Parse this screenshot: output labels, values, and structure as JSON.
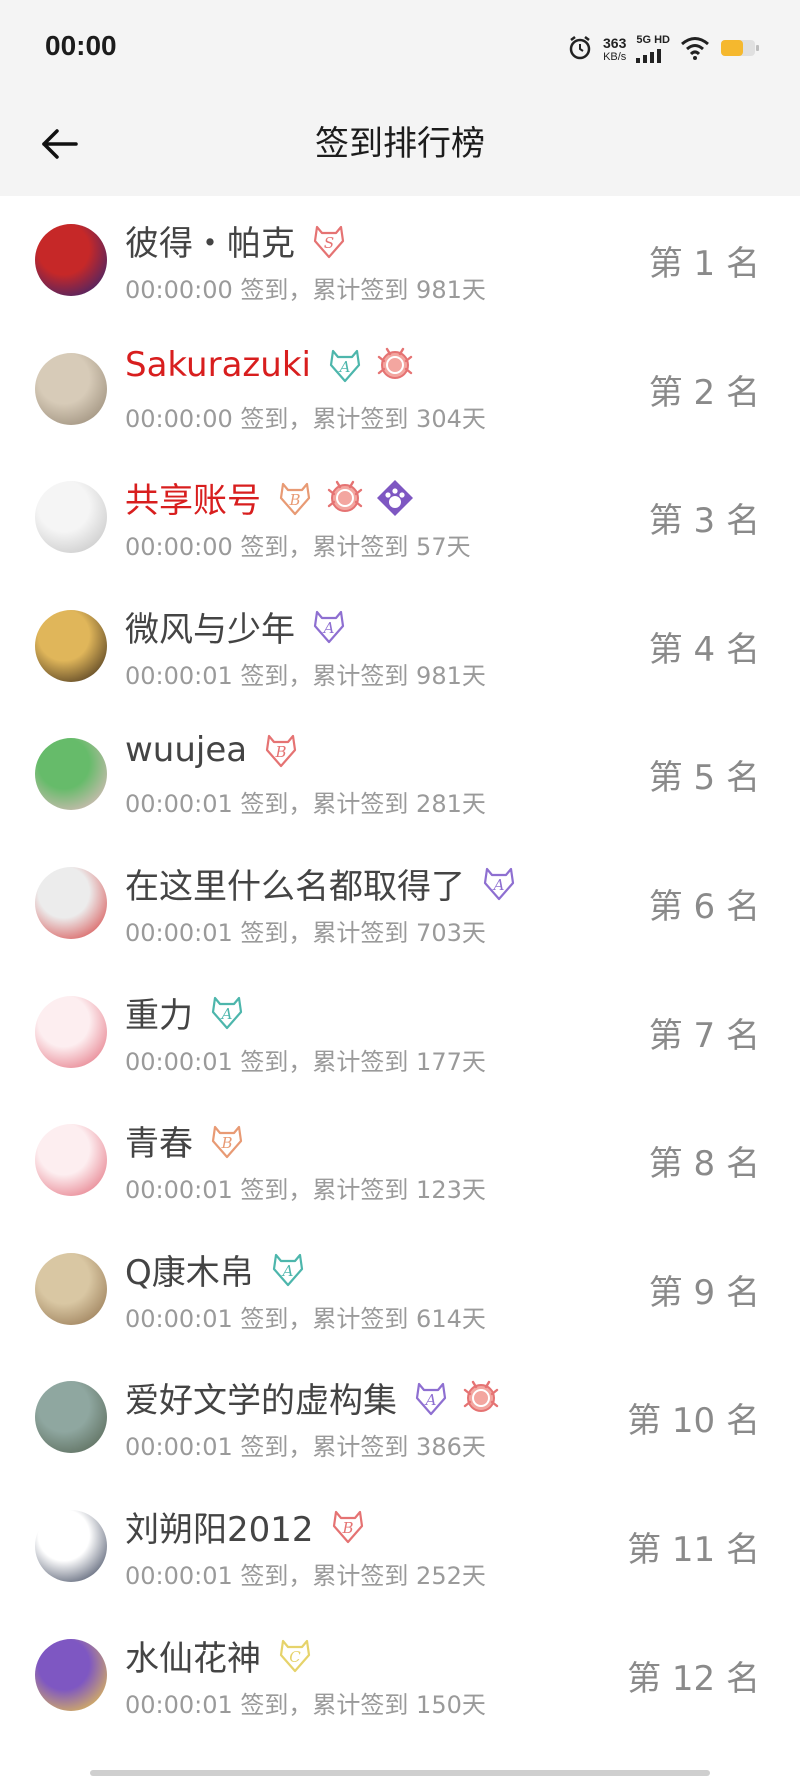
{
  "status_bar": {
    "time": "00:00",
    "net_speed_value": "363",
    "net_speed_unit": "KB/s",
    "network_label": "5G HD"
  },
  "header": {
    "title": "签到排行榜"
  },
  "rows": [
    {
      "name": "彼得・帕克",
      "highlight": false,
      "info": "00:00:00 签到，累计签到 981天",
      "rank": "第 1 名",
      "avatar_colors": [
        "#c62828",
        "#1a237e"
      ],
      "badges": [
        {
          "type": "letter",
          "letter": "S",
          "color": "#e57373"
        }
      ]
    },
    {
      "name": "Sakurazuki",
      "highlight": true,
      "info": "00:00:00 签到，累计签到 304天",
      "rank": "第 2 名",
      "avatar_colors": [
        "#d7cbb8",
        "#8d7f6c"
      ],
      "badges": [
        {
          "type": "letter",
          "letter": "A",
          "color": "#4db6ac"
        },
        {
          "type": "crab",
          "color": "#e57373"
        }
      ]
    },
    {
      "name": "共享账号",
      "highlight": true,
      "info": "00:00:00 签到，累计签到 57天",
      "rank": "第 3 名",
      "avatar_colors": [
        "#f5f5f5",
        "#bdbdbd"
      ],
      "badges": [
        {
          "type": "letter",
          "letter": "B",
          "color": "#e89a74"
        },
        {
          "type": "crab",
          "color": "#e57373"
        },
        {
          "type": "paw",
          "color": "#7e57c2"
        }
      ]
    },
    {
      "name": "微风与少年",
      "highlight": false,
      "info": "00:00:01 签到，累计签到 981天",
      "rank": "第 4 名",
      "avatar_colors": [
        "#e0b65a",
        "#2b1d12"
      ],
      "badges": [
        {
          "type": "letter",
          "letter": "A",
          "color": "#8e6fd1"
        }
      ]
    },
    {
      "name": "wuujea",
      "highlight": false,
      "info": "00:00:01 签到，累计签到 281天",
      "rank": "第 5 名",
      "avatar_colors": [
        "#66bb6a",
        "#f8bbd0"
      ],
      "badges": [
        {
          "type": "letter",
          "letter": "B",
          "color": "#e57373"
        }
      ]
    },
    {
      "name": "在这里什么名都取得了",
      "highlight": false,
      "info": "00:00:01 签到，累计签到 703天",
      "rank": "第 6 名",
      "avatar_colors": [
        "#ececec",
        "#d32f2f"
      ],
      "badges": [
        {
          "type": "letter",
          "letter": "A",
          "color": "#8e6fd1"
        }
      ]
    },
    {
      "name": "重力",
      "highlight": false,
      "info": "00:00:01 签到，累计签到 177天",
      "rank": "第 7 名",
      "avatar_colors": [
        "#fdeef0",
        "#e06070"
      ],
      "badges": [
        {
          "type": "letter",
          "letter": "A",
          "color": "#4db6ac"
        }
      ]
    },
    {
      "name": "青春",
      "highlight": false,
      "info": "00:00:01 签到，累计签到 123天",
      "rank": "第 8 名",
      "avatar_colors": [
        "#fdeef0",
        "#e06070"
      ],
      "badges": [
        {
          "type": "letter",
          "letter": "B",
          "color": "#e89a74"
        }
      ]
    },
    {
      "name": "Q康木帛",
      "highlight": false,
      "info": "00:00:01 签到，累计签到 614天",
      "rank": "第 9 名",
      "avatar_colors": [
        "#d9c7a3",
        "#8a6a45"
      ],
      "badges": [
        {
          "type": "letter",
          "letter": "A",
          "color": "#4db6ac"
        }
      ]
    },
    {
      "name": "爱好文学的虚构集",
      "highlight": false,
      "info": "00:00:01 签到，累计签到 386天",
      "rank": "第 10 名",
      "avatar_colors": [
        "#8fa7a0",
        "#4e5d4a"
      ],
      "badges": [
        {
          "type": "letter",
          "letter": "A",
          "color": "#8e6fd1"
        },
        {
          "type": "crab",
          "color": "#e57373"
        }
      ]
    },
    {
      "name": "刘朔阳2012",
      "highlight": false,
      "info": "00:00:01 签到，累计签到 252天",
      "rank": "第 11 名",
      "avatar_colors": [
        "#ffffff",
        "#1f2a44"
      ],
      "badges": [
        {
          "type": "letter",
          "letter": "B",
          "color": "#e57373"
        }
      ]
    },
    {
      "name": "水仙花神",
      "highlight": false,
      "info": "00:00:01 签到，累计签到 150天",
      "rank": "第 12 名",
      "avatar_colors": [
        "#7e57c2",
        "#fdd835"
      ],
      "badges": [
        {
          "type": "letter",
          "letter": "C",
          "color": "#e6d36b"
        }
      ]
    }
  ]
}
